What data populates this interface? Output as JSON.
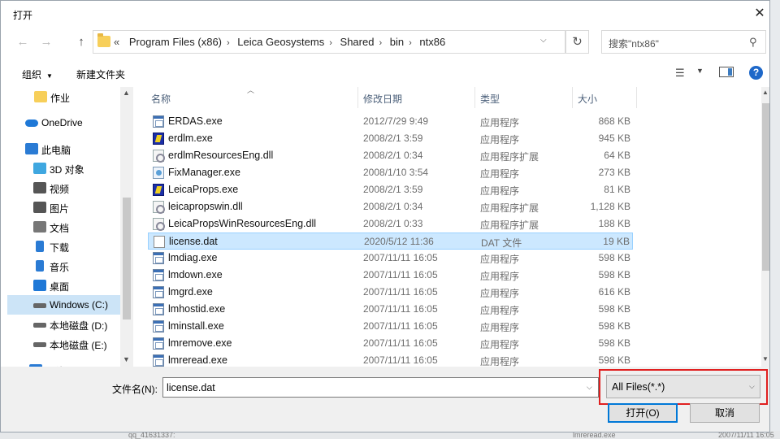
{
  "window": {
    "title": "打开",
    "close_glyph": "✕"
  },
  "nav_buttons": {
    "back": "←",
    "forward": "→",
    "up": "↑"
  },
  "address": {
    "prefix": "«",
    "crumbs": [
      "Program Files (x86)",
      "Leica Geosystems",
      "Shared",
      "bin",
      "ntx86"
    ],
    "separator": "›",
    "dropdown": "⌵",
    "refresh": "↻"
  },
  "search": {
    "placeholder": "搜索\"ntx86\"",
    "icon": "⚲"
  },
  "toolbar": {
    "organize": "组织",
    "organize_caret": "▼",
    "new_folder": "新建文件夹",
    "view_glyph": "☰",
    "view_caret": "▼",
    "help": "?"
  },
  "nav": {
    "items": [
      {
        "label": "作业",
        "icon": "folder-icon",
        "color": "#f7cf5a"
      },
      {
        "label": "OneDrive",
        "icon": "cloud-icon",
        "color": "#1e78d7"
      },
      {
        "label": "此电脑",
        "icon": "computer-icon",
        "color": "#2a7bd4"
      },
      {
        "label": "3D 对象",
        "icon": "cube-icon",
        "color": "#3fa7e0"
      },
      {
        "label": "视频",
        "icon": "video-icon",
        "color": "#555555"
      },
      {
        "label": "图片",
        "icon": "pictures-icon",
        "color": "#555555"
      },
      {
        "label": "文档",
        "icon": "document-icon",
        "color": "#777777"
      },
      {
        "label": "下载",
        "icon": "download-icon",
        "color": "#2a7bd4"
      },
      {
        "label": "音乐",
        "icon": "music-icon",
        "color": "#2a7bd4"
      },
      {
        "label": "桌面",
        "icon": "desktop-icon",
        "color": "#1e78d7"
      },
      {
        "label": "Windows (C:)",
        "icon": "drive-icon",
        "color": "#666666"
      },
      {
        "label": "本地磁盘 (D:)",
        "icon": "drive-icon",
        "color": "#666666"
      },
      {
        "label": "本地磁盘 (E:)",
        "icon": "drive-icon",
        "color": "#666666"
      },
      {
        "label": "网络",
        "icon": "network-icon",
        "color": "#2a7bd4"
      }
    ]
  },
  "columns": {
    "name": "名称",
    "date": "修改日期",
    "type": "类型",
    "size": "大小",
    "sort_glyph": "︿"
  },
  "files": [
    {
      "name": "ERDAS.exe",
      "date": "2012/7/29 9:49",
      "type": "应用程序",
      "size": "868 KB",
      "icon": "exe"
    },
    {
      "name": "erdlm.exe",
      "date": "2008/2/1 3:59",
      "type": "应用程序",
      "size": "945 KB",
      "icon": "leica"
    },
    {
      "name": "erdlmResourcesEng.dll",
      "date": "2008/2/1 0:34",
      "type": "应用程序扩展",
      "size": "64 KB",
      "icon": "dll"
    },
    {
      "name": "FixManager.exe",
      "date": "2008/1/10 3:54",
      "type": "应用程序",
      "size": "273 KB",
      "icon": "fix"
    },
    {
      "name": "LeicaProps.exe",
      "date": "2008/2/1 3:59",
      "type": "应用程序",
      "size": "81 KB",
      "icon": "leica"
    },
    {
      "name": "leicapropswin.dll",
      "date": "2008/2/1 0:34",
      "type": "应用程序扩展",
      "size": "1,128 KB",
      "icon": "dll"
    },
    {
      "name": "LeicaPropsWinResourcesEng.dll",
      "date": "2008/2/1 0:33",
      "type": "应用程序扩展",
      "size": "188 KB",
      "icon": "dll"
    },
    {
      "name": "license.dat",
      "date": "2020/5/12 11:36",
      "type": "DAT 文件",
      "size": "19 KB",
      "icon": "dat",
      "selected": true
    },
    {
      "name": "lmdiag.exe",
      "date": "2007/11/11 16:05",
      "type": "应用程序",
      "size": "598 KB",
      "icon": "exe"
    },
    {
      "name": "lmdown.exe",
      "date": "2007/11/11 16:05",
      "type": "应用程序",
      "size": "598 KB",
      "icon": "exe"
    },
    {
      "name": "lmgrd.exe",
      "date": "2007/11/11 16:05",
      "type": "应用程序",
      "size": "616 KB",
      "icon": "exe"
    },
    {
      "name": "lmhostid.exe",
      "date": "2007/11/11 16:05",
      "type": "应用程序",
      "size": "598 KB",
      "icon": "exe"
    },
    {
      "name": "lminstall.exe",
      "date": "2007/11/11 16:05",
      "type": "应用程序",
      "size": "598 KB",
      "icon": "exe"
    },
    {
      "name": "lmremove.exe",
      "date": "2007/11/11 16:05",
      "type": "应用程序",
      "size": "598 KB",
      "icon": "exe"
    },
    {
      "name": "lmreread.exe",
      "date": "2007/11/11 16:05",
      "type": "应用程序",
      "size": "598 KB",
      "icon": "exe"
    }
  ],
  "filename": {
    "label": "文件名(N):",
    "value": "license.dat",
    "dropdown": "⌵"
  },
  "filter": {
    "value": "All Files(*.*)",
    "dropdown": "⌵",
    "highlight_color": "#e02020"
  },
  "buttons": {
    "open": "打开(O)",
    "cancel": "取消"
  },
  "scroll": {
    "up": "▲",
    "down": "▼"
  },
  "background": {
    "bottom_left_text": "qq_41631337:",
    "bottom_right_name": "lmreread.exe",
    "bottom_right_date": "2007/11/11 16:05"
  }
}
